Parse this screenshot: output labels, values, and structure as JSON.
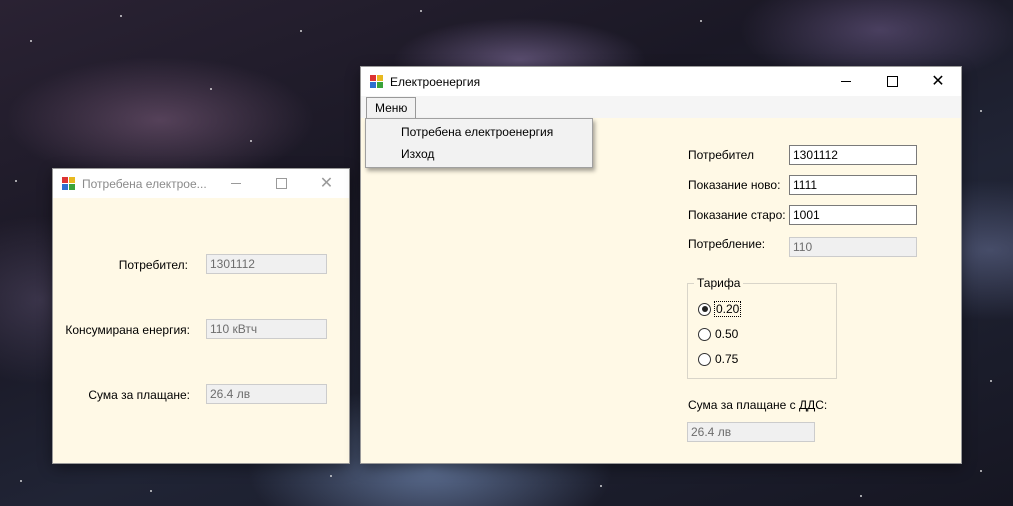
{
  "bill_window": {
    "title": "Потребена електрое...",
    "consumer_label": "Потребител:",
    "consumer_value": "1301112",
    "energy_label": "Консумирана енергия:",
    "energy_value": "110  кВтч",
    "amount_label": "Сума за плащане:",
    "amount_value": "26.4 лв"
  },
  "main_window": {
    "title": "Електроенергия",
    "menu": {
      "label": "Меню",
      "items": [
        "Потребена електроенергия",
        "Изход"
      ]
    },
    "consumer_label": "Потребител",
    "consumer_value": "1301112",
    "reading_new_label": "Показание ново:",
    "reading_new_value": "1111",
    "reading_old_label": "Показание старо:",
    "reading_old_value": "1001",
    "consumption_label": "Потребление:",
    "consumption_value": "110",
    "tariff": {
      "label": "Тарифа",
      "options": [
        "0.20",
        "0.50",
        "0.75"
      ],
      "selected": "0.20"
    },
    "vat_amount_label": "Сума за плащане с ДДС:",
    "vat_amount_value": "26.4 лв"
  },
  "colors": {
    "window_background": "#fff9e6",
    "titlebar": "#ffffff"
  },
  "icons": [
    "app-icon",
    "minimize-icon",
    "maximize-icon",
    "close-icon"
  ]
}
